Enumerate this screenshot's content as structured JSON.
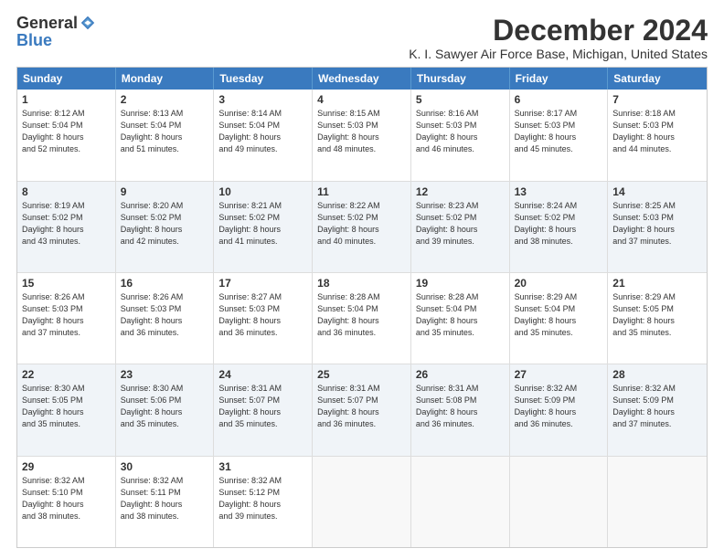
{
  "logo": {
    "general": "General",
    "blue": "Blue"
  },
  "title": "December 2024",
  "subtitle": "K. I. Sawyer Air Force Base, Michigan, United States",
  "header_days": [
    "Sunday",
    "Monday",
    "Tuesday",
    "Wednesday",
    "Thursday",
    "Friday",
    "Saturday"
  ],
  "weeks": [
    [
      {
        "day": "1",
        "lines": [
          "Sunrise: 8:12 AM",
          "Sunset: 5:04 PM",
          "Daylight: 8 hours",
          "and 52 minutes."
        ]
      },
      {
        "day": "2",
        "lines": [
          "Sunrise: 8:13 AM",
          "Sunset: 5:04 PM",
          "Daylight: 8 hours",
          "and 51 minutes."
        ]
      },
      {
        "day": "3",
        "lines": [
          "Sunrise: 8:14 AM",
          "Sunset: 5:04 PM",
          "Daylight: 8 hours",
          "and 49 minutes."
        ]
      },
      {
        "day": "4",
        "lines": [
          "Sunrise: 8:15 AM",
          "Sunset: 5:03 PM",
          "Daylight: 8 hours",
          "and 48 minutes."
        ]
      },
      {
        "day": "5",
        "lines": [
          "Sunrise: 8:16 AM",
          "Sunset: 5:03 PM",
          "Daylight: 8 hours",
          "and 46 minutes."
        ]
      },
      {
        "day": "6",
        "lines": [
          "Sunrise: 8:17 AM",
          "Sunset: 5:03 PM",
          "Daylight: 8 hours",
          "and 45 minutes."
        ]
      },
      {
        "day": "7",
        "lines": [
          "Sunrise: 8:18 AM",
          "Sunset: 5:03 PM",
          "Daylight: 8 hours",
          "and 44 minutes."
        ]
      }
    ],
    [
      {
        "day": "8",
        "lines": [
          "Sunrise: 8:19 AM",
          "Sunset: 5:02 PM",
          "Daylight: 8 hours",
          "and 43 minutes."
        ]
      },
      {
        "day": "9",
        "lines": [
          "Sunrise: 8:20 AM",
          "Sunset: 5:02 PM",
          "Daylight: 8 hours",
          "and 42 minutes."
        ]
      },
      {
        "day": "10",
        "lines": [
          "Sunrise: 8:21 AM",
          "Sunset: 5:02 PM",
          "Daylight: 8 hours",
          "and 41 minutes."
        ]
      },
      {
        "day": "11",
        "lines": [
          "Sunrise: 8:22 AM",
          "Sunset: 5:02 PM",
          "Daylight: 8 hours",
          "and 40 minutes."
        ]
      },
      {
        "day": "12",
        "lines": [
          "Sunrise: 8:23 AM",
          "Sunset: 5:02 PM",
          "Daylight: 8 hours",
          "and 39 minutes."
        ]
      },
      {
        "day": "13",
        "lines": [
          "Sunrise: 8:24 AM",
          "Sunset: 5:02 PM",
          "Daylight: 8 hours",
          "and 38 minutes."
        ]
      },
      {
        "day": "14",
        "lines": [
          "Sunrise: 8:25 AM",
          "Sunset: 5:03 PM",
          "Daylight: 8 hours",
          "and 37 minutes."
        ]
      }
    ],
    [
      {
        "day": "15",
        "lines": [
          "Sunrise: 8:26 AM",
          "Sunset: 5:03 PM",
          "Daylight: 8 hours",
          "and 37 minutes."
        ]
      },
      {
        "day": "16",
        "lines": [
          "Sunrise: 8:26 AM",
          "Sunset: 5:03 PM",
          "Daylight: 8 hours",
          "and 36 minutes."
        ]
      },
      {
        "day": "17",
        "lines": [
          "Sunrise: 8:27 AM",
          "Sunset: 5:03 PM",
          "Daylight: 8 hours",
          "and 36 minutes."
        ]
      },
      {
        "day": "18",
        "lines": [
          "Sunrise: 8:28 AM",
          "Sunset: 5:04 PM",
          "Daylight: 8 hours",
          "and 36 minutes."
        ]
      },
      {
        "day": "19",
        "lines": [
          "Sunrise: 8:28 AM",
          "Sunset: 5:04 PM",
          "Daylight: 8 hours",
          "and 35 minutes."
        ]
      },
      {
        "day": "20",
        "lines": [
          "Sunrise: 8:29 AM",
          "Sunset: 5:04 PM",
          "Daylight: 8 hours",
          "and 35 minutes."
        ]
      },
      {
        "day": "21",
        "lines": [
          "Sunrise: 8:29 AM",
          "Sunset: 5:05 PM",
          "Daylight: 8 hours",
          "and 35 minutes."
        ]
      }
    ],
    [
      {
        "day": "22",
        "lines": [
          "Sunrise: 8:30 AM",
          "Sunset: 5:05 PM",
          "Daylight: 8 hours",
          "and 35 minutes."
        ]
      },
      {
        "day": "23",
        "lines": [
          "Sunrise: 8:30 AM",
          "Sunset: 5:06 PM",
          "Daylight: 8 hours",
          "and 35 minutes."
        ]
      },
      {
        "day": "24",
        "lines": [
          "Sunrise: 8:31 AM",
          "Sunset: 5:07 PM",
          "Daylight: 8 hours",
          "and 35 minutes."
        ]
      },
      {
        "day": "25",
        "lines": [
          "Sunrise: 8:31 AM",
          "Sunset: 5:07 PM",
          "Daylight: 8 hours",
          "and 36 minutes."
        ]
      },
      {
        "day": "26",
        "lines": [
          "Sunrise: 8:31 AM",
          "Sunset: 5:08 PM",
          "Daylight: 8 hours",
          "and 36 minutes."
        ]
      },
      {
        "day": "27",
        "lines": [
          "Sunrise: 8:32 AM",
          "Sunset: 5:09 PM",
          "Daylight: 8 hours",
          "and 36 minutes."
        ]
      },
      {
        "day": "28",
        "lines": [
          "Sunrise: 8:32 AM",
          "Sunset: 5:09 PM",
          "Daylight: 8 hours",
          "and 37 minutes."
        ]
      }
    ],
    [
      {
        "day": "29",
        "lines": [
          "Sunrise: 8:32 AM",
          "Sunset: 5:10 PM",
          "Daylight: 8 hours",
          "and 38 minutes."
        ]
      },
      {
        "day": "30",
        "lines": [
          "Sunrise: 8:32 AM",
          "Sunset: 5:11 PM",
          "Daylight: 8 hours",
          "and 38 minutes."
        ]
      },
      {
        "day": "31",
        "lines": [
          "Sunrise: 8:32 AM",
          "Sunset: 5:12 PM",
          "Daylight: 8 hours",
          "and 39 minutes."
        ]
      },
      {
        "day": "",
        "lines": []
      },
      {
        "day": "",
        "lines": []
      },
      {
        "day": "",
        "lines": []
      },
      {
        "day": "",
        "lines": []
      }
    ]
  ]
}
